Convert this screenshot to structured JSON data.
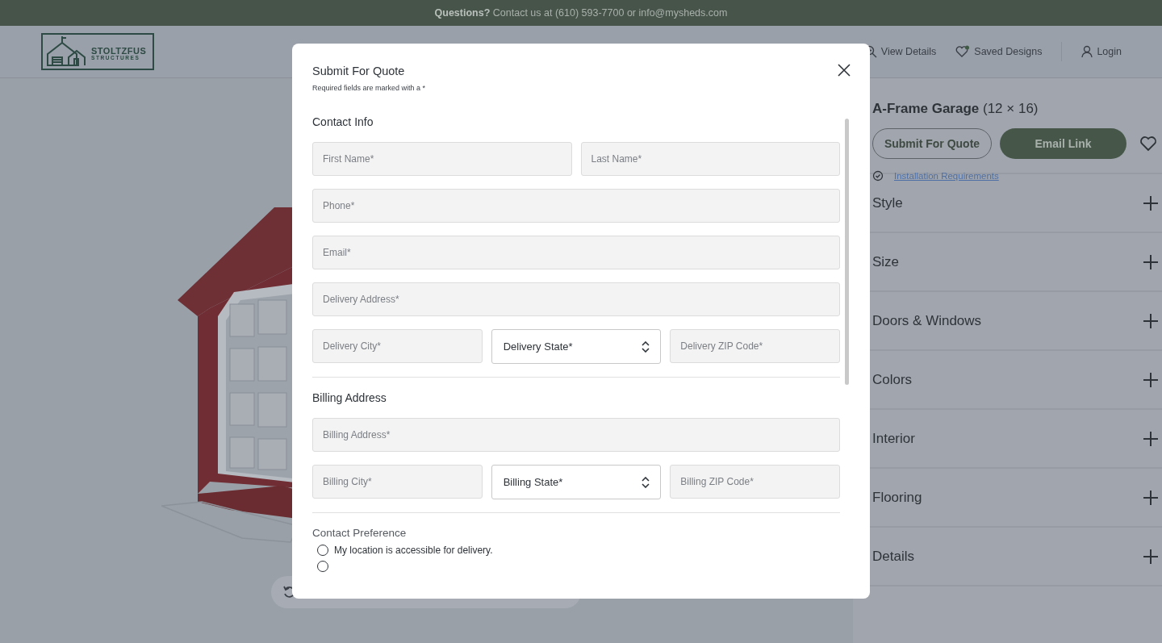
{
  "top_bar": {
    "text": "**Questions?** Contact us at (610) 593-7700 or info@mysheds.com"
  },
  "header": {
    "logo": {
      "line1": "STOLTZFUS",
      "line2": "STRUCTURES"
    },
    "nav": [
      {
        "label": "View Details"
      },
      {
        "label": "Saved Designs"
      },
      {
        "label": "Login"
      }
    ]
  },
  "product": {
    "title": "A-Frame Garage",
    "size": "(12 × 16)",
    "buttons": [
      {
        "label": "Submit For Quote",
        "kind": "outline"
      },
      {
        "label": "Email Link",
        "kind": "filled"
      }
    ],
    "link": "Installation Requirements"
  },
  "accordion": [
    {
      "label": "Style",
      "expanded": false
    },
    {
      "label": "Size",
      "expanded": false
    },
    {
      "label": "Doors & Windows",
      "expanded": false
    },
    {
      "label": "Colors",
      "expanded": false
    },
    {
      "label": "Interior",
      "expanded": false
    },
    {
      "label": "Flooring",
      "expanded": false
    },
    {
      "label": "Details",
      "expanded": false
    }
  ],
  "modal": {
    "title": "Submit For Quote",
    "note": "Required fields are marked with a *",
    "sections": [
      {
        "heading": "Contact Info",
        "rows": [
          [
            {
              "kind": "input",
              "placeholder": "First Name*"
            },
            {
              "kind": "input",
              "placeholder": "Last Name*"
            }
          ],
          [
            {
              "kind": "input",
              "placeholder": "Phone*"
            }
          ],
          [
            {
              "kind": "input",
              "placeholder": "Email*"
            }
          ],
          [
            {
              "kind": "input",
              "placeholder": "Delivery Address*"
            }
          ],
          [
            {
              "kind": "input",
              "placeholder": "Delivery City*"
            },
            {
              "kind": "select",
              "value": "Delivery State*"
            },
            {
              "kind": "input",
              "placeholder": "Delivery ZIP Code*"
            }
          ]
        ]
      },
      {
        "heading": "Billing Address",
        "rows": [
          [
            {
              "kind": "input",
              "placeholder": "Billing Address*"
            }
          ],
          [
            {
              "kind": "input",
              "placeholder": "Billing City*"
            },
            {
              "kind": "select",
              "value": "Billing State*"
            },
            {
              "kind": "input",
              "placeholder": "Billing ZIP Code*"
            }
          ]
        ]
      }
    ],
    "contact_preference": {
      "heading": "Contact Preference",
      "options": [
        {
          "label": "My location is accessible for delivery.",
          "selected": false
        },
        {
          "selected": false
        }
      ]
    }
  }
}
